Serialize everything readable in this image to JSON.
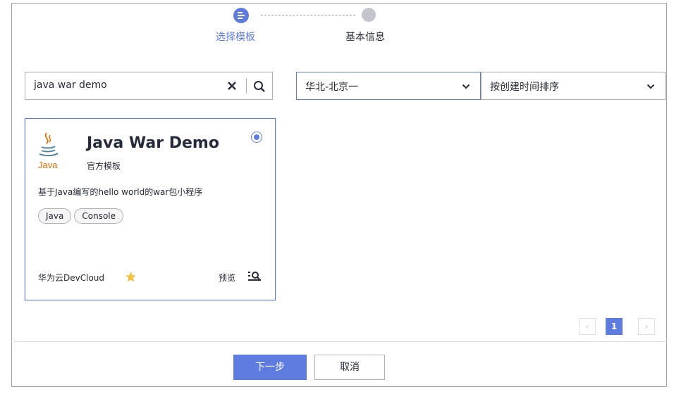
{
  "steps": [
    {
      "label": "选择模板",
      "state": "active",
      "icon": "list-icon"
    },
    {
      "label": "基本信息",
      "state": "pending"
    }
  ],
  "search": {
    "value": "java war demo"
  },
  "filters": {
    "region": "华北-北京一",
    "sort": "按创建时间排序"
  },
  "card": {
    "logo_text": "Java",
    "title": "Java War Demo",
    "subtitle": "官方模板",
    "description": "基于Java编写的hello world的war包小程序",
    "tags": [
      "Java",
      "Console"
    ],
    "publisher": "华为云DevCloud",
    "preview": "预览",
    "selected": true
  },
  "pagination": {
    "current": "1"
  },
  "buttons": {
    "next": "下一步",
    "cancel": "取消"
  },
  "colors": {
    "accent": "#5e7ce0",
    "star": "#f5c542",
    "java_red": "#e76f00",
    "java_blue": "#5382a1"
  }
}
